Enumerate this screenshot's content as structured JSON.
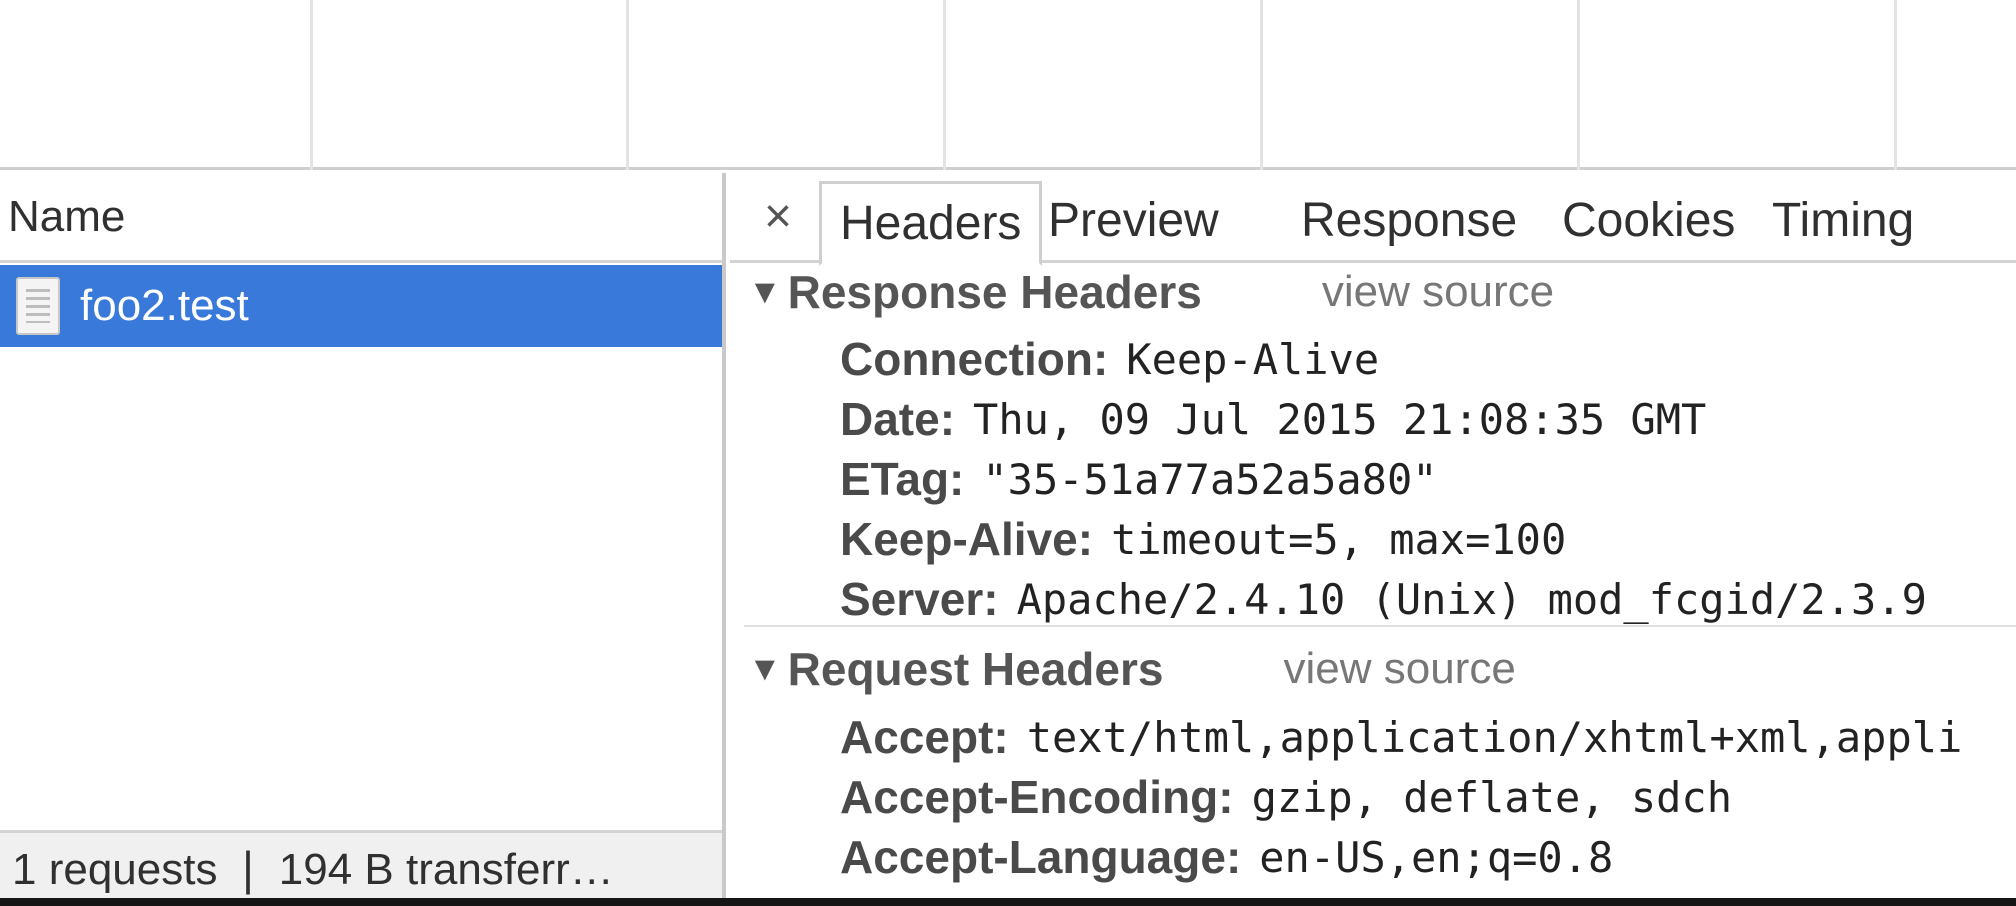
{
  "left_panel": {
    "name_column_header": "Name",
    "requests": [
      {
        "name": "foo2.test",
        "icon": "document-icon",
        "selected": true
      }
    ],
    "status_text": "1 requests  ❘  194 B transferr…"
  },
  "details": {
    "close_label": "×",
    "tabs": [
      {
        "label": "Headers",
        "selected": true
      },
      {
        "label": "Preview",
        "selected": false
      },
      {
        "label": "Response",
        "selected": false
      },
      {
        "label": "Cookies",
        "selected": false
      },
      {
        "label": "Timing",
        "selected": false
      }
    ],
    "response_headers": {
      "title": "Response Headers",
      "view_source": "view source",
      "rows": [
        {
          "name": "Connection:",
          "value": "Keep-Alive"
        },
        {
          "name": "Date:",
          "value": "Thu, 09 Jul 2015 21:08:35 GMT"
        },
        {
          "name": "ETag:",
          "value": "\"35-51a77a52a5a80\""
        },
        {
          "name": "Keep-Alive:",
          "value": "timeout=5, max=100"
        },
        {
          "name": "Server:",
          "value": "Apache/2.4.10 (Unix) mod_fcgid/2.3.9"
        }
      ]
    },
    "request_headers": {
      "title": "Request Headers",
      "view_source": "view source",
      "rows": [
        {
          "name": "Accept:",
          "value": "text/html,application/xhtml+xml,appli"
        },
        {
          "name": "Accept-Encoding:",
          "value": "gzip, deflate, sdch"
        },
        {
          "name": "Accept-Language:",
          "value": "en-US,en;q=0.8"
        }
      ]
    }
  },
  "colors": {
    "selection": "#3879d9",
    "border": "#d3d3d3",
    "status_bar": "#f0f0f0"
  }
}
